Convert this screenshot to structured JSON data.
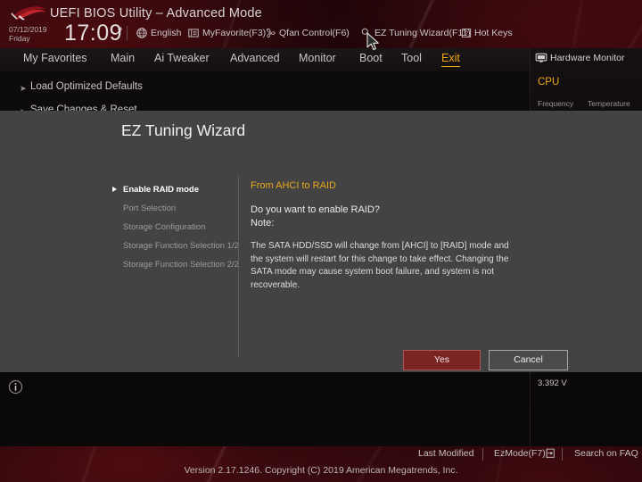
{
  "header": {
    "logo_name": "rog-logo",
    "title": "UEFI BIOS Utility – Advanced Mode",
    "date": "07/12/2019",
    "weekday": "Friday",
    "time": "17:09",
    "gear_icon": "gear-icon",
    "items": [
      {
        "label": "English",
        "icon": "globe-icon"
      },
      {
        "label": "MyFavorite(F3)",
        "icon": "favorite-icon"
      },
      {
        "label": "Qfan Control(F6)",
        "icon": "fan-icon"
      },
      {
        "label": "EZ Tuning Wizard(F11)",
        "icon": "wizard-icon"
      },
      {
        "label": "Hot Keys",
        "icon": "hotkeys-icon"
      }
    ]
  },
  "nav": {
    "tabs": [
      {
        "label": "My Favorites",
        "active": false
      },
      {
        "label": "Main",
        "active": false
      },
      {
        "label": "Ai Tweaker",
        "active": false
      },
      {
        "label": "Advanced",
        "active": false
      },
      {
        "label": "Monitor",
        "active": false
      },
      {
        "label": "Boot",
        "active": false
      },
      {
        "label": "Tool",
        "active": false
      },
      {
        "label": "Exit",
        "active": true
      }
    ]
  },
  "left_menu": {
    "items": [
      {
        "label": "Load Optimized Defaults"
      },
      {
        "label": "Save Changes & Reset"
      }
    ]
  },
  "hardware_monitor": {
    "title": "Hardware Monitor",
    "icon": "monitor-icon",
    "group_cpu": "CPU",
    "col_frequency": "Frequency",
    "col_temperature": "Temperature",
    "voltage_value": "3.392 V"
  },
  "wizard": {
    "title": "EZ Tuning Wizard",
    "steps": [
      {
        "label": "Enable RAID mode",
        "active": true
      },
      {
        "label": "Port Selection",
        "active": false
      },
      {
        "label": "Storage Configuration",
        "active": false
      },
      {
        "label": "Storage Function Selection 1/2",
        "active": false
      },
      {
        "label": "Storage Function Selection 2/2",
        "active": false
      }
    ],
    "heading": "From AHCI to RAID",
    "question": "Do you want to enable RAID?",
    "note_label": "Note:",
    "body": "The SATA HDD/SSD will change from [AHCI] to [RAID] mode and the system will restart for this change to take effect. Changing the SATA mode may cause system boot failure, and system is not recoverable.",
    "yes_label": "Yes",
    "cancel_label": "Cancel"
  },
  "footer": {
    "last_modified": "Last Modified",
    "ezmode": "EzMode(F7)|",
    "ezmode_icon": "exit-arrow-icon",
    "search_faq": "Search on FAQ",
    "version": "Version 2.17.1246. Copyright (C) 2019 American Megatrends, Inc."
  },
  "colors": {
    "accent_orange": "#f0a818",
    "dialog_bg": "#434343",
    "yes_button": "#7b2424",
    "brand_red": "#8e1219"
  }
}
